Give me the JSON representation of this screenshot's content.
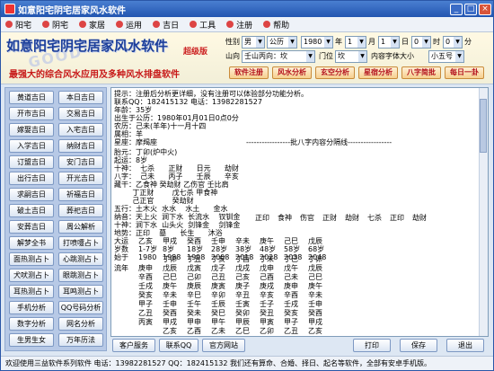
{
  "window": {
    "title": "如意阳宅阴宅居家风水软件",
    "min_label": "_",
    "max_label": "□",
    "close_label": "×"
  },
  "menu": {
    "items": [
      "阳宅",
      "阴宅",
      "家居",
      "运用",
      "吉日",
      "工具",
      "注册",
      "帮助"
    ]
  },
  "banner": {
    "title": "如意阳宅阴宅居家风水软件",
    "edition": "超级版",
    "subtitle": "最强大的综合风水应用及多种风水排盘软件",
    "watermark": "GOOD"
  },
  "form": {
    "gender_label": "性别",
    "gender_value": "男",
    "calendar_value": "公历",
    "year_value": "1980",
    "year_unit": "年",
    "month_value": "1",
    "month_unit": "月",
    "day_value": "1",
    "day_unit": "日",
    "hour_value": "0",
    "hour_unit": "时",
    "minute_value": "0",
    "minute_unit": "分",
    "mountain_label": "山向",
    "mountain_value": "壬山丙向：坎",
    "door_label": "门位",
    "door_value": "坎",
    "fontsize_label": "内容字体大小",
    "fontsize_value": "小五号"
  },
  "action_buttons": [
    "软件注册",
    "风水分析",
    "玄空分析",
    "星宿分析",
    "八字简批",
    "每日一卦"
  ],
  "sidebar": {
    "buttons": [
      "黄道吉日",
      "本日吉日",
      "开市吉日",
      "交易吉日",
      "嫁娶吉日",
      "入宅吉日",
      "入学吉日",
      "纳财吉日",
      "订盟吉日",
      "安门吉日",
      "出行吉日",
      "开光吉日",
      "求嗣吉日",
      "祈福吉日",
      "破土吉日",
      "葬祀吉日",
      "安葬吉日",
      "周公解析",
      "解梦全书",
      "打喷嚏占卜",
      "面热测占卜",
      "心跳测占卜",
      "犬吠测占卜",
      "眼跳测占卜",
      "耳热测占卜",
      "耳鸣测占卜",
      "手机分析",
      "QQ号码分析",
      "数字分析",
      "网名分析",
      "生男生女",
      "万年历法"
    ]
  },
  "content": {
    "lines_top": [
      "提示：注册后分析更详细，没有注册可以体验部分功能分析。",
      "联系QQ：182415132 电话：13982281527",
      "年龄：35岁",
      "出生于公历：1980年01月01日0点0分",
      "农历：己未(羊年)十一月十四",
      "属相：羊",
      "星座：摩羯座",
      "",
      "-----------------批八字内容分隔线-----------------"
    ],
    "lines_mid": [
      "胎元：丁卯(炉中火)",
      "起运：8岁",
      "十神：  七杀      正财      日元      劫财",
      "八字：  己未      丙子      壬辰      辛亥",
      "藏干：乙食神 癸劫财 乙伤官 壬比肩",
      "        丁正财        戊七杀 甲食神",
      "        己正官        癸劫财",
      "五行：土木火  水水    水土      金水",
      "纳音：天上火  涧下水  长流水    钗钏金",
      "十神：涧下水  山头火  剑锋金    剑锋金",
      "地势：正印    墓      长生      沐浴"
    ],
    "dayun_rows": {
      "ten_gods": [
        "正印",
        "食神",
        "伤官",
        "正财",
        "劫财",
        "七杀",
        "正印",
        "劫财"
      ],
      "dayun": [
        "乙亥",
        "甲戌",
        "癸酉",
        "壬申",
        "辛未",
        "庚午",
        "己巳",
        "戊辰"
      ],
      "ages": [
        "1-7岁",
        "8岁",
        "18岁",
        "28岁",
        "38岁",
        "48岁",
        "58岁",
        "68岁"
      ],
      "years": [
        "1980",
        "1988",
        "1998",
        "2008",
        "2018",
        "2028",
        "2038",
        "2048"
      ],
      "years_label": "始于",
      "dayun_label": "大运",
      "ages_label": "岁数"
    },
    "liunian_label": "流年",
    "liunian_cols": [
      "庚申\n辛酉\n壬戌\n癸亥\n甲子\n乙丑\n丙寅",
      "丁卯\n戊辰\n己巳\n庚午\n辛未\n壬申\n癸酉\n甲戌\n乙亥\n丙子",
      "丁丑\n戊寅\n己卯\n庚辰\n辛巳\n壬午\n癸未\n甲申\n乙酉\n丙戌",
      "丁亥\n戊子\n己丑\n庚寅\n辛卯\n壬辰\n癸巳\n甲午\n乙未\n丙申",
      "丁酉\n戊戌\n己亥\n庚子\n辛丑\n壬寅\n癸卯\n甲辰\n乙巳\n丙午",
      "丁未\n戊申\n己酉\n庚戌\n辛亥\n壬子\n癸丑\n甲寅\n乙卯\n丙辰",
      "丁巳\n戊午\n己未\n庚申\n辛酉\n壬戌\n癸亥\n甲子\n乙丑\n丙寅",
      "丁卯\n戊辰\n己巳\n庚午\n辛未\n壬申\n癸酉\n甲戌\n乙亥\n丙子"
    ]
  },
  "bottom_buttons": {
    "service": "客户服务",
    "qq": "联系QQ",
    "website": "官方网站",
    "print": "打印",
    "save": "保存",
    "exit": "退出"
  },
  "status": {
    "text": "欢迎使用三益软件系列软件 电话：13982281527 QQ：182415132   我们还有算命、合婚、择日、起名等软件，全部有安卓手机版。"
  }
}
